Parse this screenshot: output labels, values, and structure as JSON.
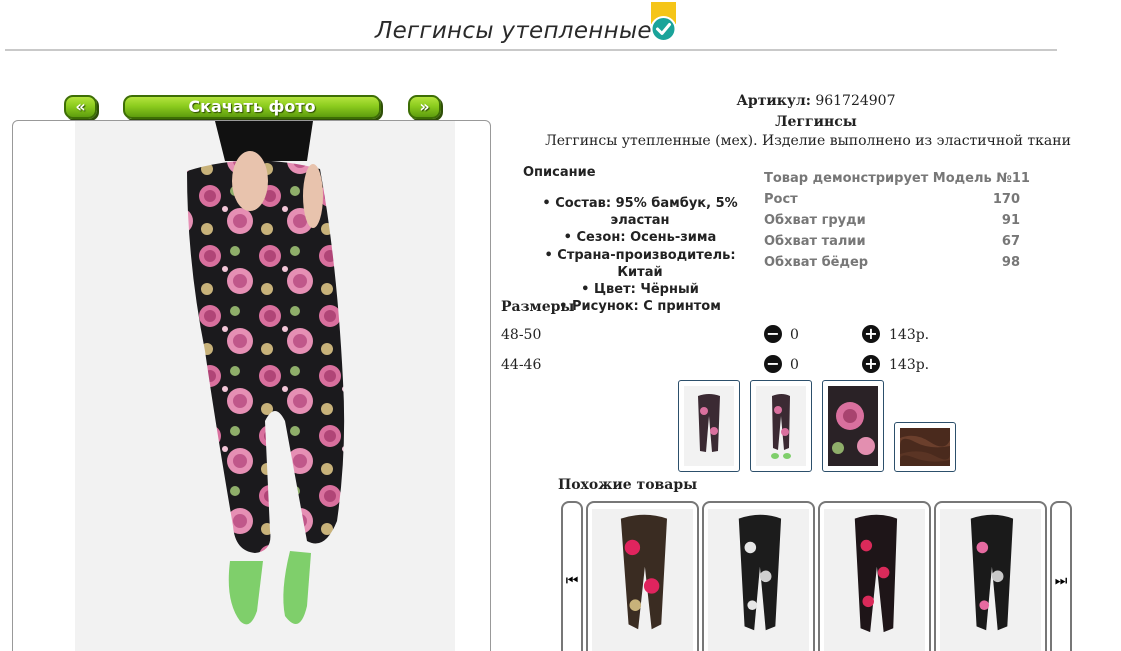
{
  "header": {
    "title": "Леггинсы утепленные"
  },
  "gallery": {
    "prev_label": "«",
    "download_label": "Скачать фото",
    "next_label": "»"
  },
  "product": {
    "sku_label": "Артикул:",
    "sku_value": "961724907",
    "type": "Леггинсы",
    "description": "Леггинсы утепленные (мех). Изделие выполнено из эластичной ткани",
    "description_heading": "Описание",
    "features": [
      "Состав: 95% бамбук, 5% эластан",
      "Сезон: Осень-зима",
      "Страна-производитель: Китай",
      "Цвет: Чёрный",
      "Рисунок: С принтом"
    ]
  },
  "model": {
    "heading": "Товар демонстрирует Модель №11",
    "rows": [
      {
        "label": "Рост",
        "value": "170"
      },
      {
        "label": "Обхват груди",
        "value": "91"
      },
      {
        "label": "Обхват талии",
        "value": "67"
      },
      {
        "label": "Обхват бёдер",
        "value": "98"
      }
    ]
  },
  "sizes": {
    "heading": "Размеры",
    "rows": [
      {
        "size": "48-50",
        "qty": "0",
        "price": "143р."
      },
      {
        "size": "44-46",
        "qty": "0",
        "price": "143р."
      }
    ]
  },
  "similar": {
    "heading": "Похожие товары",
    "prev_icon": "⏮",
    "next_icon": "⏭"
  },
  "icons": {
    "badge": "verified-check-icon",
    "minus": "minus-circle-icon",
    "plus": "plus-circle-icon"
  },
  "colors": {
    "button_green": "#8ccc1e",
    "badge_teal": "#1aa39a",
    "badge_yellow": "#f5c518"
  }
}
